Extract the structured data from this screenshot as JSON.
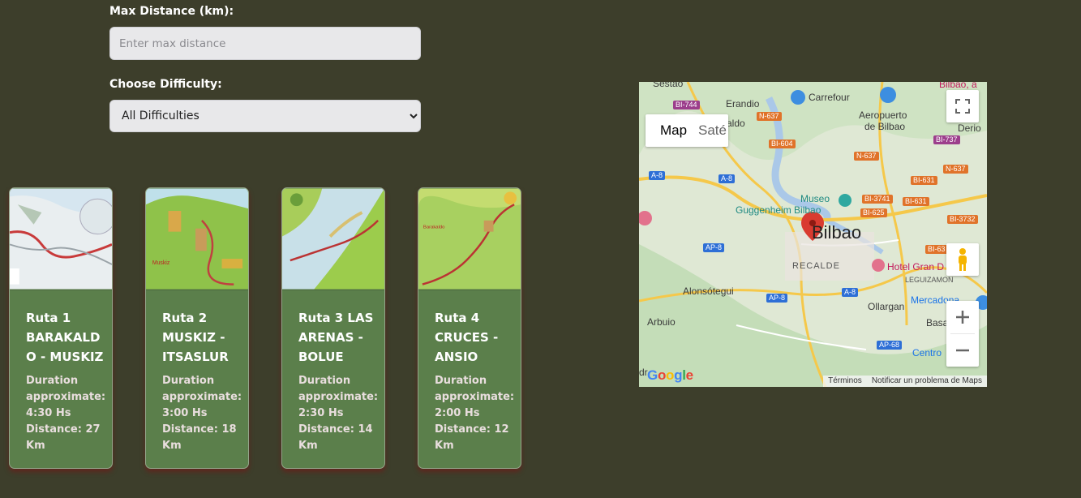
{
  "filters": {
    "distance_label": "Max Distance (km):",
    "distance_placeholder": "Enter max distance",
    "difficulty_label": "Choose Difficulty:",
    "difficulty_selected": "All Difficulties"
  },
  "routes": [
    {
      "title": "Ruta 1 BARAKALDO - MUSKIZ",
      "duration_label": "Duration approximate:",
      "duration": "4:30 Hs",
      "distance": "Distance: 27 Km"
    },
    {
      "title": "Ruta 2 MUSKIZ - ITSASLUR",
      "duration_label": "Duration approximate:",
      "duration": "3:00 Hs",
      "distance": "Distance: 18 Km"
    },
    {
      "title": "Ruta 3 LAS ARENAS - BOLUE",
      "duration_label": "Duration approximate:",
      "duration": "2:30 Hs",
      "distance": "Distance: 14 Km"
    },
    {
      "title": "Ruta 4 CRUCES - ANSIO",
      "duration_label": "Duration approximate:",
      "duration": "2:00 Hs",
      "distance": "Distance: 12 Km"
    }
  ],
  "map": {
    "type_map": "Map",
    "type_satellite": "Saté",
    "city": "Bilbao",
    "places": {
      "sestao": "Sestao",
      "erandio": "Erandio",
      "carrefour": "Carrefour",
      "aeropuerto": "Aeropuerto",
      "de_bilbao": "de Bilbao",
      "derio": "Derio",
      "museo": "Museo",
      "guggenheim": "Guggenheim Bilbao",
      "recalde": "RECALDE",
      "hotel": "Hotel Gran D",
      "leguizamon": "LEGUIZAMON",
      "alonsotegui": "Alonsótegui",
      "ollargan": "Ollargan",
      "arbuio": "Arbuio",
      "mercadona": "Mercadona",
      "basa": "Basa",
      "centro": "Centro",
      "aldo": "aldo",
      "bilbao_top": "Bilbao, a",
      "dr": "dr"
    },
    "roads": [
      "BI-744",
      "N-637",
      "BI-604",
      "BI-737",
      "N-637",
      "BI-631",
      "N-637",
      "A-8",
      "A-8",
      "BI-3741",
      "BI-631",
      "BI-625",
      "BI-3732",
      "AP-8",
      "AP-8",
      "A-8",
      "BI-63",
      "AP-68",
      "AP-8"
    ],
    "footer_terms": "Términos",
    "footer_report": "Notificar un problema de Maps",
    "google": "Google"
  },
  "colors": {
    "background": "#3d3e2b",
    "card": "#5b7f4b",
    "map_marker": "#d93b30"
  }
}
